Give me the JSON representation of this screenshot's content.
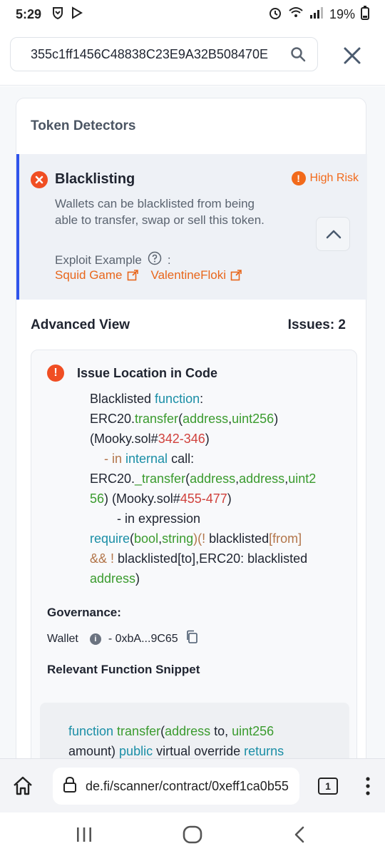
{
  "status_bar": {
    "time": "5:29",
    "battery": "19%",
    "icons": [
      "shield-icon",
      "play-icon",
      "alarm-icon",
      "wifi-icon",
      "signal-icon",
      "battery-icon"
    ]
  },
  "search": {
    "value": "355c1ff1456C48838C23E9A32B508470E"
  },
  "detectors": {
    "section_title": "Token Detectors",
    "item": {
      "title": "Blacklisting",
      "risk_label": "High Risk",
      "description": "Wallets can be blacklisted from being able to transfer, swap or sell this token.",
      "exploit_label": "Exploit Example",
      "exploits": [
        "Squid Game",
        "ValentineFloki"
      ]
    }
  },
  "advanced": {
    "title": "Advanced View",
    "issues": "Issues: 2",
    "issue_location_title": "Issue Location in Code",
    "code": {
      "l1_a": "Blacklisted ",
      "l1_b": "function",
      "l1_c": ":",
      "l2_a": "ERC20.",
      "l2_b": "transfer",
      "l2_c": "(",
      "l2_d": "address",
      "l2_e": ",",
      "l2_f": "uint256",
      "l2_g": ")",
      "l3_a": "(Mooky.sol#",
      "l3_b": "342-346",
      "l3_c": ")",
      "l4_a": "- in ",
      "l4_b": "internal",
      "l4_c": " call:",
      "l5_a": "ERC20.",
      "l5_b": "_transfer",
      "l5_c": "(",
      "l5_d": "address",
      "l5_e": ",",
      "l5_f": "address",
      "l5_g": ",",
      "l5_h": "uint2",
      "l6_a": "56",
      "l6_b": ") (Mooky.sol#",
      "l6_c": "455-477",
      "l6_d": ")",
      "l7_a": "- in expression",
      "l8_a": "require",
      "l8_b": "(",
      "l8_c": "bool",
      "l8_d": ",",
      "l8_e": "string",
      "l8_f": ")(! ",
      "l8_g": "blacklisted",
      "l8_h": "[",
      "l8_i": "from",
      "l8_j": "]",
      "l9_a": "&& ! ",
      "l9_b": "blacklisted",
      "l9_c": "[to],ERC20: blacklisted",
      "l10_a": "address",
      "l10_b": ")"
    },
    "governance_title": "Governance:",
    "wallet_label": "Wallet",
    "wallet_value": "- 0xbA...9C65",
    "snippet_title": "Relevant Function Snippet",
    "snippet": {
      "s1_a": "function",
      "s1_b": " transfer",
      "s1_c": "(",
      "s1_d": "address",
      "s1_e": " to, ",
      "s1_f": "uint256",
      "s2_a": "amount) ",
      "s2_b": "public",
      "s2_c": " virtual override ",
      "s2_d": "returns"
    }
  },
  "browser": {
    "url": "de.fi/scanner/contract/0xeff1ca0b55",
    "tab_count": "1"
  },
  "colors": {
    "accent_blue": "#2f54eb",
    "risk_orange": "#f26a1b",
    "error_red": "#f04e23",
    "keyword": "#1a8ea6",
    "function_green": "#3a9b2e",
    "line_ref_red": "#d0413c"
  }
}
